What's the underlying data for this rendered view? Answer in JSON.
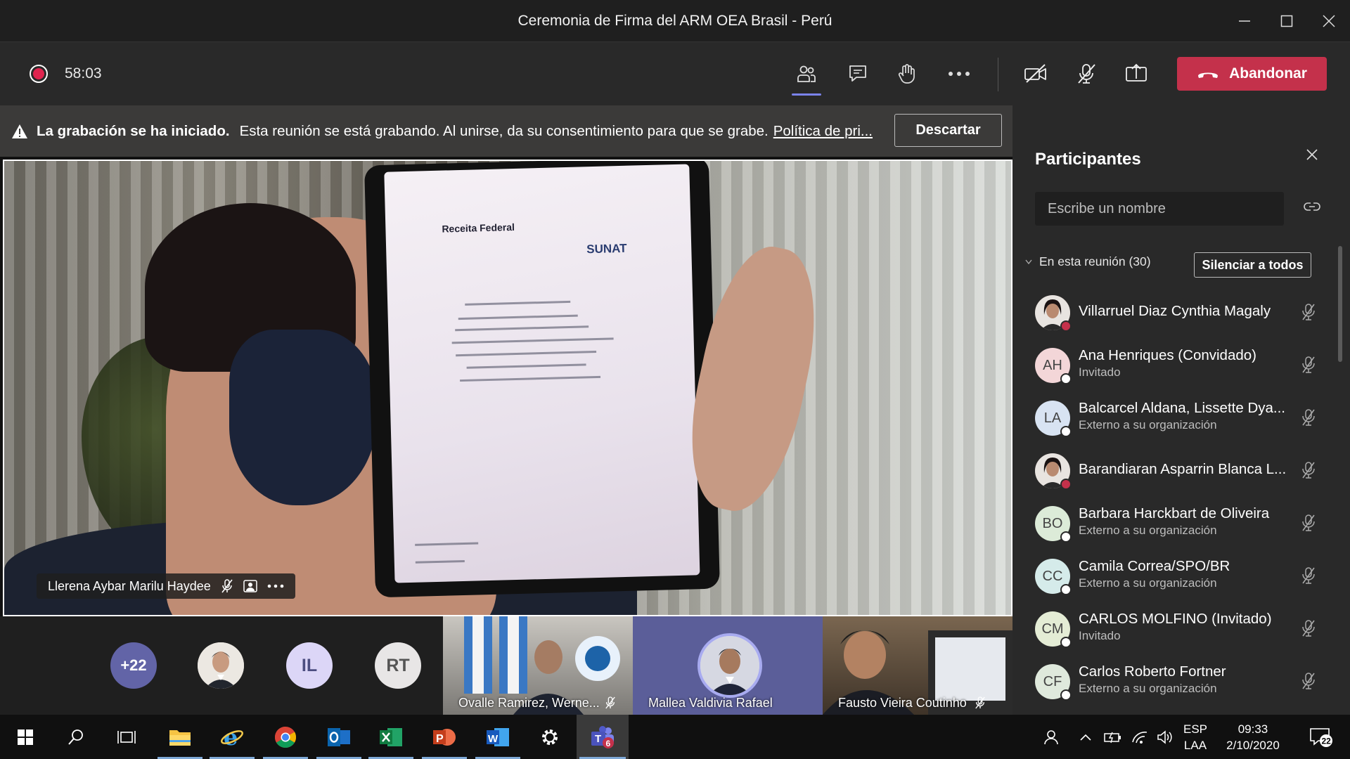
{
  "window": {
    "title": "Ceremonia de Firma del ARM OEA Brasil - Perú"
  },
  "toolbar": {
    "timer": "58:03",
    "leave_label": "Abandonar"
  },
  "banner": {
    "title": "La grabación se ha iniciado.",
    "message": "Esta reunión se está grabando. Al unirse, da su consentimiento para que se grabe.",
    "link": "Política de pri...",
    "dismiss_label": "Descartar"
  },
  "main_video": {
    "speaker_name": "Llerena Aybar Marilu Haydee",
    "doc_logo_left": "Receita Federal",
    "doc_logo_right": "SUNAT"
  },
  "strip": {
    "overflow": "+22",
    "avatars": [
      {
        "initials": "IL",
        "color": "#dcd6f7"
      },
      {
        "initials": "RT",
        "color": "#e8e6e6"
      }
    ],
    "tiles": [
      {
        "name": "Ovalle Ramirez, Werne..."
      },
      {
        "name": "Mallea Valdivia Rafael"
      },
      {
        "name": "Fausto Vieira Coutinho"
      }
    ]
  },
  "participants": {
    "title": "Participantes",
    "search_placeholder": "Escribe un nombre",
    "section_label": "En esta reunión (30)",
    "mute_all_label": "Silenciar a todos",
    "list": [
      {
        "name": "Villarruel Diaz Cynthia Magaly",
        "subtitle": "",
        "initials": "",
        "avatar_color": "#7a5a4e",
        "status": "#c4314b",
        "photo": true
      },
      {
        "name": "Ana Henriques (Convidado)",
        "subtitle": "Invitado",
        "initials": "AH",
        "avatar_color": "#f3d6d8",
        "status": "#ffffff",
        "photo": false
      },
      {
        "name": "Balcarcel Aldana, Lissette Dya...",
        "subtitle": "Externo a su organización",
        "initials": "LA",
        "avatar_color": "#d8e3f2",
        "status": "#ffffff",
        "photo": false
      },
      {
        "name": "Barandiaran Asparrin Blanca L...",
        "subtitle": "",
        "initials": "",
        "avatar_color": "#6a4d44",
        "status": "#c4314b",
        "photo": true
      },
      {
        "name": "Barbara Harckbart de Oliveira",
        "subtitle": "Externo a su organización",
        "initials": "BO",
        "avatar_color": "#dcebd8",
        "status": "#ffffff",
        "photo": false
      },
      {
        "name": "Camila Correa/SPO/BR",
        "subtitle": "Externo a su organización",
        "initials": "CC",
        "avatar_color": "#d5ebea",
        "status": "#ffffff",
        "photo": false
      },
      {
        "name": "CARLOS MOLFINO (Invitado)",
        "subtitle": "Invitado",
        "initials": "CM",
        "avatar_color": "#e4ecd5",
        "status": "#ffffff",
        "photo": false
      },
      {
        "name": "Carlos Roberto Fortner",
        "subtitle": "Externo a su organización",
        "initials": "CF",
        "avatar_color": "#dfe9dc",
        "status": "#ffffff",
        "photo": false
      }
    ]
  },
  "taskbar": {
    "lang_top": "ESP",
    "lang_bottom": "LAA",
    "time": "09:33",
    "date": "2/10/2020",
    "teams_badge": "6",
    "notifications": "22"
  },
  "colors": {
    "accent": "#6264a7",
    "leave": "#c4314b",
    "record": "#e0234e",
    "panel_bg": "#292929"
  }
}
